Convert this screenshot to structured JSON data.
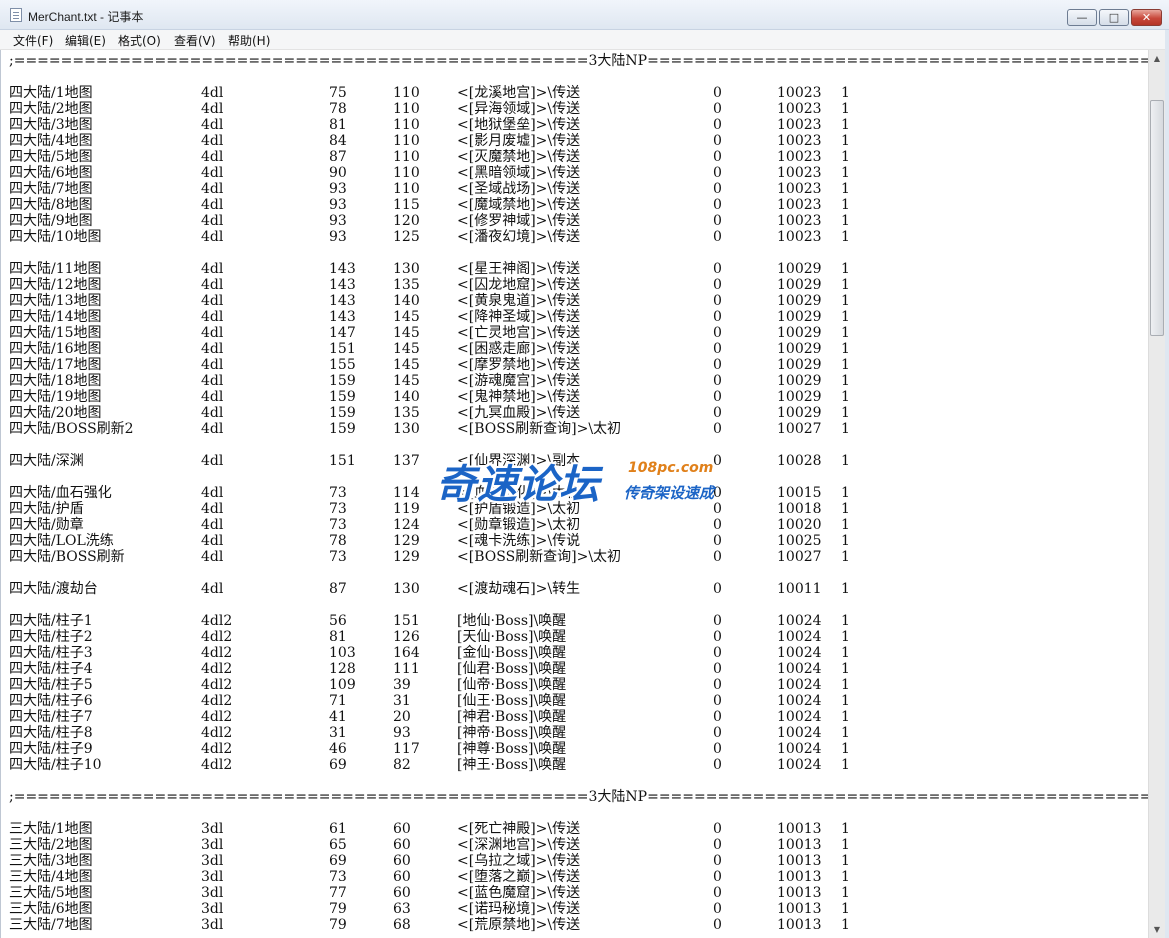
{
  "window": {
    "title": "MerChant.txt - 记事本",
    "min_label": "—",
    "max_label": "□",
    "close_label": "✕"
  },
  "menu": [
    {
      "label": "文件(F)"
    },
    {
      "label": "编辑(E)"
    },
    {
      "label": "格式(O)"
    },
    {
      "label": "查看(V)"
    },
    {
      "label": "帮助(H)"
    }
  ],
  "scrollbar": {
    "up_icon": "▲",
    "down_icon": "▼"
  },
  "watermark": {
    "main": "奇速论坛",
    "domain": "108pc.com",
    "slogan": "传奇架设速成"
  },
  "document": {
    "lines": [
      {
        "text": ";=================================================3大陆NP==================================================="
      },
      {
        "blank": true
      },
      {
        "cols": [
          "四大陆/1地图",
          "4dl",
          "75",
          "110",
          "<[龙溪地宫]>\\传送",
          "0",
          "10023",
          "1"
        ]
      },
      {
        "cols": [
          "四大陆/2地图",
          "4dl",
          "78",
          "110",
          "<[异海领域]>\\传送",
          "0",
          "10023",
          "1"
        ]
      },
      {
        "cols": [
          "四大陆/3地图",
          "4dl",
          "81",
          "110",
          "<[地狱堡垒]>\\传送",
          "0",
          "10023",
          "1"
        ]
      },
      {
        "cols": [
          "四大陆/4地图",
          "4dl",
          "84",
          "110",
          "<[影月废墟]>\\传送",
          "0",
          "10023",
          "1"
        ]
      },
      {
        "cols": [
          "四大陆/5地图",
          "4dl",
          "87",
          "110",
          "<[灭魔禁地]>\\传送",
          "0",
          "10023",
          "1"
        ]
      },
      {
        "cols": [
          "四大陆/6地图",
          "4dl",
          "90",
          "110",
          "<[黑暗领域]>\\传送",
          "0",
          "10023",
          "1"
        ]
      },
      {
        "cols": [
          "四大陆/7地图",
          "4dl",
          "93",
          "110",
          "<[圣域战场]>\\传送",
          "0",
          "10023",
          "1"
        ]
      },
      {
        "cols": [
          "四大陆/8地图",
          "4dl",
          "93",
          "115",
          "<[魔域禁地]>\\传送",
          "0",
          "10023",
          "1"
        ]
      },
      {
        "cols": [
          "四大陆/9地图",
          "4dl",
          "93",
          "120",
          "<[修罗神域]>\\传送",
          "0",
          "10023",
          "1"
        ]
      },
      {
        "cols": [
          "四大陆/10地图",
          "4dl",
          "93",
          "125",
          "<[潘夜幻境]>\\传送",
          "0",
          "10023",
          "1"
        ]
      },
      {
        "blank": true
      },
      {
        "cols": [
          "四大陆/11地图",
          "4dl",
          "143",
          "130",
          "<[星王神阁]>\\传送",
          "0",
          "10029",
          "1"
        ]
      },
      {
        "cols": [
          "四大陆/12地图",
          "4dl",
          "143",
          "135",
          "<[囚龙地窟]>\\传送",
          "0",
          "10029",
          "1"
        ]
      },
      {
        "cols": [
          "四大陆/13地图",
          "4dl",
          "143",
          "140",
          "<[黄泉鬼道]>\\传送",
          "0",
          "10029",
          "1"
        ]
      },
      {
        "cols": [
          "四大陆/14地图",
          "4dl",
          "143",
          "145",
          "<[降神圣域]>\\传送",
          "0",
          "10029",
          "1"
        ]
      },
      {
        "cols": [
          "四大陆/15地图",
          "4dl",
          "147",
          "145",
          "<[亡灵地宫]>\\传送",
          "0",
          "10029",
          "1"
        ]
      },
      {
        "cols": [
          "四大陆/16地图",
          "4dl",
          "151",
          "145",
          "<[困惑走廊]>\\传送",
          "0",
          "10029",
          "1"
        ]
      },
      {
        "cols": [
          "四大陆/17地图",
          "4dl",
          "155",
          "145",
          "<[摩罗禁地]>\\传送",
          "0",
          "10029",
          "1"
        ]
      },
      {
        "cols": [
          "四大陆/18地图",
          "4dl",
          "159",
          "145",
          "<[游魂魔宫]>\\传送",
          "0",
          "10029",
          "1"
        ]
      },
      {
        "cols": [
          "四大陆/19地图",
          "4dl",
          "159",
          "140",
          "<[鬼神禁地]>\\传送",
          "0",
          "10029",
          "1"
        ]
      },
      {
        "cols": [
          "四大陆/20地图",
          "4dl",
          "159",
          "135",
          "<[九冥血殿]>\\传送",
          "0",
          "10029",
          "1"
        ]
      },
      {
        "cols": [
          "四大陆/BOSS刷新2",
          "4dl",
          "159",
          "130",
          "<[BOSS刷新查询]>\\太初",
          "0",
          "10027",
          "1"
        ]
      },
      {
        "blank": true
      },
      {
        "cols": [
          "四大陆/深渊",
          "4dl",
          "151",
          "137",
          "<[仙界深渊]>\\副本",
          "0",
          "10028",
          "1"
        ]
      },
      {
        "blank": true
      },
      {
        "cols": [
          "四大陆/血石强化",
          "4dl",
          "73",
          "114",
          "<[血石强化]>\\太初",
          "0",
          "10015",
          "1"
        ]
      },
      {
        "cols": [
          "四大陆/护盾",
          "4dl",
          "73",
          "119",
          "<[护盾锻造]>\\太初",
          "0",
          "10018",
          "1"
        ]
      },
      {
        "cols": [
          "四大陆/勋章",
          "4dl",
          "73",
          "124",
          "<[勋章锻造]>\\太初",
          "0",
          "10020",
          "1"
        ]
      },
      {
        "cols": [
          "四大陆/LOL洗练",
          "4dl",
          "78",
          "129",
          "<[魂卡洗练]>\\传说",
          "0",
          "10025",
          "1"
        ]
      },
      {
        "cols": [
          "四大陆/BOSS刷新",
          "4dl",
          "73",
          "129",
          "<[BOSS刷新查询]>\\太初",
          "0",
          "10027",
          "1"
        ]
      },
      {
        "blank": true
      },
      {
        "cols": [
          "四大陆/渡劫台",
          "4dl",
          "87",
          "130",
          "<[渡劫魂石]>\\转生",
          "0",
          "10011",
          "1"
        ]
      },
      {
        "blank": true
      },
      {
        "cols": [
          "四大陆/柱子1",
          "4dl2",
          "56",
          "151",
          "[地仙·Boss]\\唤醒",
          "0",
          "10024",
          "1"
        ]
      },
      {
        "cols": [
          "四大陆/柱子2",
          "4dl2",
          "81",
          "126",
          "[天仙·Boss]\\唤醒",
          "0",
          "10024",
          "1"
        ]
      },
      {
        "cols": [
          "四大陆/柱子3",
          "4dl2",
          "103",
          "164",
          "[金仙·Boss]\\唤醒",
          "0",
          "10024",
          "1"
        ]
      },
      {
        "cols": [
          "四大陆/柱子4",
          "4dl2",
          "128",
          "111",
          "[仙君·Boss]\\唤醒",
          "0",
          "10024",
          "1"
        ]
      },
      {
        "cols": [
          "四大陆/柱子5",
          "4dl2",
          "109",
          "39",
          "[仙帝·Boss]\\唤醒",
          "0",
          "10024",
          "1"
        ]
      },
      {
        "cols": [
          "四大陆/柱子6",
          "4dl2",
          "71",
          "31",
          "[仙王·Boss]\\唤醒",
          "0",
          "10024",
          "1"
        ]
      },
      {
        "cols": [
          "四大陆/柱子7",
          "4dl2",
          "41",
          "20",
          "[神君·Boss]\\唤醒",
          "0",
          "10024",
          "1"
        ]
      },
      {
        "cols": [
          "四大陆/柱子8",
          "4dl2",
          "31",
          "93",
          "[神帝·Boss]\\唤醒",
          "0",
          "10024",
          "1"
        ]
      },
      {
        "cols": [
          "四大陆/柱子9",
          "4dl2",
          "46",
          "117",
          "[神尊·Boss]\\唤醒",
          "0",
          "10024",
          "1"
        ]
      },
      {
        "cols": [
          "四大陆/柱子10",
          "4dl2",
          "69",
          "82",
          "[神王·Boss]\\唤醒",
          "0",
          "10024",
          "1"
        ]
      },
      {
        "blank": true
      },
      {
        "text": ";=================================================3大陆NP==================================================="
      },
      {
        "blank": true
      },
      {
        "cols": [
          "三大陆/1地图",
          "3dl",
          "61",
          "60",
          "<[死亡神殿]>\\传送",
          "0",
          "10013",
          "1"
        ]
      },
      {
        "cols": [
          "三大陆/2地图",
          "3dl",
          "65",
          "60",
          "<[深渊地宫]>\\传送",
          "0",
          "10013",
          "1"
        ]
      },
      {
        "cols": [
          "三大陆/3地图",
          "3dl",
          "69",
          "60",
          "<[乌拉之域]>\\传送",
          "0",
          "10013",
          "1"
        ]
      },
      {
        "cols": [
          "三大陆/4地图",
          "3dl",
          "73",
          "60",
          "<[堕落之巅]>\\传送",
          "0",
          "10013",
          "1"
        ]
      },
      {
        "cols": [
          "三大陆/5地图",
          "3dl",
          "77",
          "60",
          "<[蓝色魔窟]>\\传送",
          "0",
          "10013",
          "1"
        ]
      },
      {
        "cols": [
          "三大陆/6地图",
          "3dl",
          "79",
          "63",
          "<[诺玛秘境]>\\传送",
          "0",
          "10013",
          "1"
        ]
      },
      {
        "cols": [
          "三大陆/7地图",
          "3dl",
          "79",
          "68",
          "<[荒原禁地]>\\传送",
          "0",
          "10013",
          "1"
        ]
      }
    ]
  }
}
